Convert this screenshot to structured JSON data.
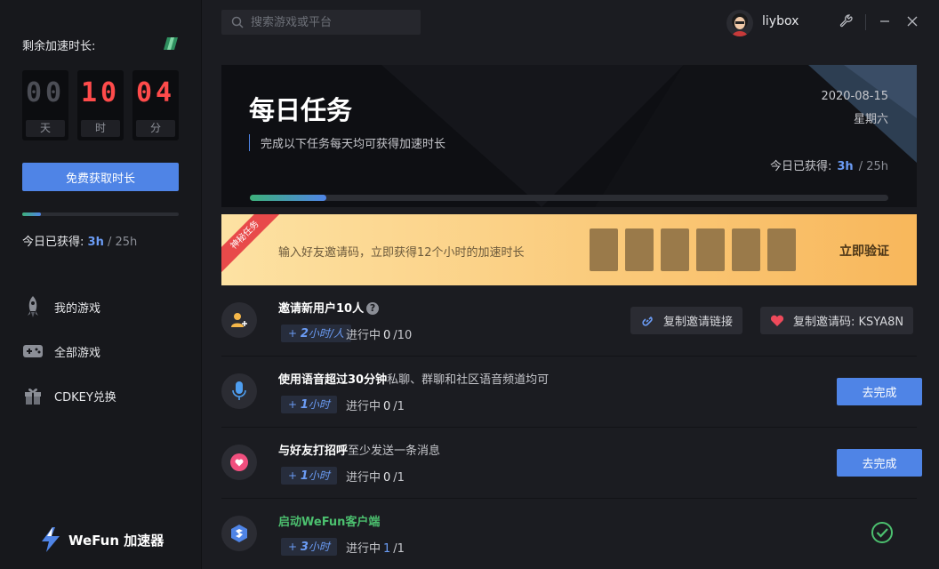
{
  "sidebar": {
    "remaining_label": "剩余加速时长:",
    "timer": [
      {
        "digits": "00",
        "unit": "天",
        "color": "#4b4d55"
      },
      {
        "digits": "10",
        "unit": "时",
        "color": "#ff4b4b"
      },
      {
        "digits": "04",
        "unit": "分",
        "color": "#ff4b4b"
      }
    ],
    "free_button": "免费获取时长",
    "progress": 0.12,
    "today_label": "今日已获得:",
    "today_value": "3h",
    "today_total": "/ 25h",
    "nav": [
      {
        "label": "我的游戏",
        "icon": "rocket-icon"
      },
      {
        "label": "全部游戏",
        "icon": "gamepad-icon"
      },
      {
        "label": "CDKEY兑换",
        "icon": "gift-icon"
      }
    ],
    "brand": "WeFun 加速器"
  },
  "topbar": {
    "search_placeholder": "搜索游戏或平台",
    "username": "liybox"
  },
  "banner": {
    "title": "每日任务",
    "subtitle": "完成以下任务每天均可获得加速时长",
    "date": "2020-08-15",
    "weekday": "星期六",
    "earned_label": "今日已获得:",
    "earned_value": "3h",
    "earned_total": "/ 25h",
    "progress": 0.12
  },
  "invite": {
    "ribbon": "神秘任务",
    "text": "输入好友邀请码，立即获得12个小时的加速时长",
    "code_boxes": 6,
    "verify_label": "立即验证"
  },
  "tasks": [
    {
      "title": "邀请新用户10人",
      "desc": "",
      "reward_value": "2",
      "reward_unit": "小时/人",
      "status_label": "进行中",
      "progress_current": "0",
      "progress_total": "/10",
      "copy_link_label": "复制邀请链接",
      "copy_code_label": "复制邀请码: KSYA8N"
    },
    {
      "title": "使用语音超过30分钟",
      "desc": "私聊、群聊和社区语音频道均可",
      "reward_value": "1",
      "reward_unit": "小时",
      "status_label": "进行中",
      "progress_current": "0",
      "progress_total": "/1",
      "button": "去完成"
    },
    {
      "title": "与好友打招呼",
      "desc": "至少发送一条消息",
      "reward_value": "1",
      "reward_unit": "小时",
      "status_label": "进行中",
      "progress_current": "0",
      "progress_total": "/1",
      "button": "去完成"
    },
    {
      "title": "启动WeFun客户端",
      "desc": "",
      "reward_value": "3",
      "reward_unit": "小时",
      "status_label": "进行中",
      "progress_current": "1",
      "progress_total": "/1",
      "completed": true
    }
  ],
  "colors": {
    "accent": "#4f84e6",
    "success": "#4cc06f",
    "digit_red": "#ff4b4b",
    "invite_gold": "#f8b75b"
  }
}
